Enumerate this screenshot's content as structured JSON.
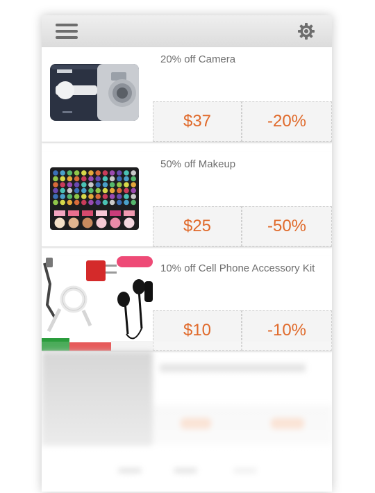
{
  "header": {
    "menu_icon": "hamburger-menu-icon",
    "settings_icon": "gear-icon"
  },
  "deals": [
    {
      "title": "20% off Camera",
      "price": "$37",
      "discount": "-20%",
      "image": "camera"
    },
    {
      "title": "50% off Makeup",
      "price": "$25",
      "discount": "-50%",
      "image": "makeup-palette"
    },
    {
      "title": "10% off Cell Phone Accessory Kit",
      "price": "$10",
      "discount": "-10%",
      "image": "phone-accessories"
    }
  ],
  "colors": {
    "accent": "#e06a2b",
    "header_bg": "#e2e2e2",
    "title_text": "#6e6e6e"
  }
}
